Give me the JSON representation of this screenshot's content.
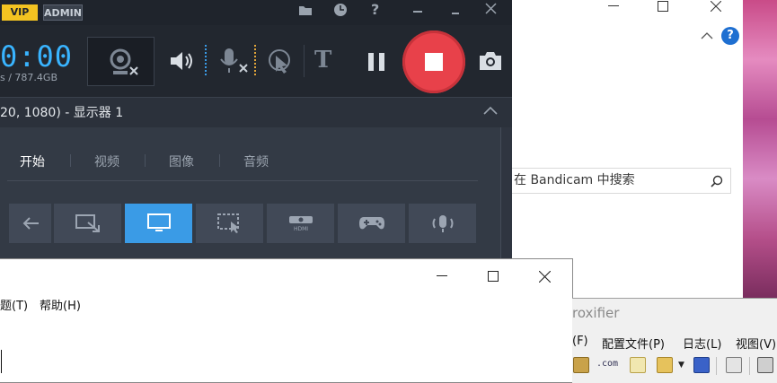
{
  "explorer": {
    "search_placeholder": "在 Bandicam 中搜索",
    "help_symbol": "?"
  },
  "bandicam": {
    "vip_label": "VIP",
    "admin_label": "ADMIN",
    "timer": "0:00",
    "storage": "s / 787.4GB",
    "source_label": "20, 1080) - 显示器 1",
    "tabs": [
      {
        "label": "开始",
        "active": true
      },
      {
        "label": "视频",
        "active": false
      },
      {
        "label": "图像",
        "active": false
      },
      {
        "label": "音频",
        "active": false
      }
    ],
    "colors": {
      "accent": "#3a9be6",
      "record": "#e8414a",
      "timer": "#39b4ff"
    }
  },
  "notepad": {
    "menu": [
      "题(T)",
      "帮助(H)"
    ]
  },
  "proxifier": {
    "title_fragment": "roxifier",
    "menu": [
      "(F)",
      "配置文件(P)",
      "日志(L)",
      "视图(V)"
    ]
  }
}
